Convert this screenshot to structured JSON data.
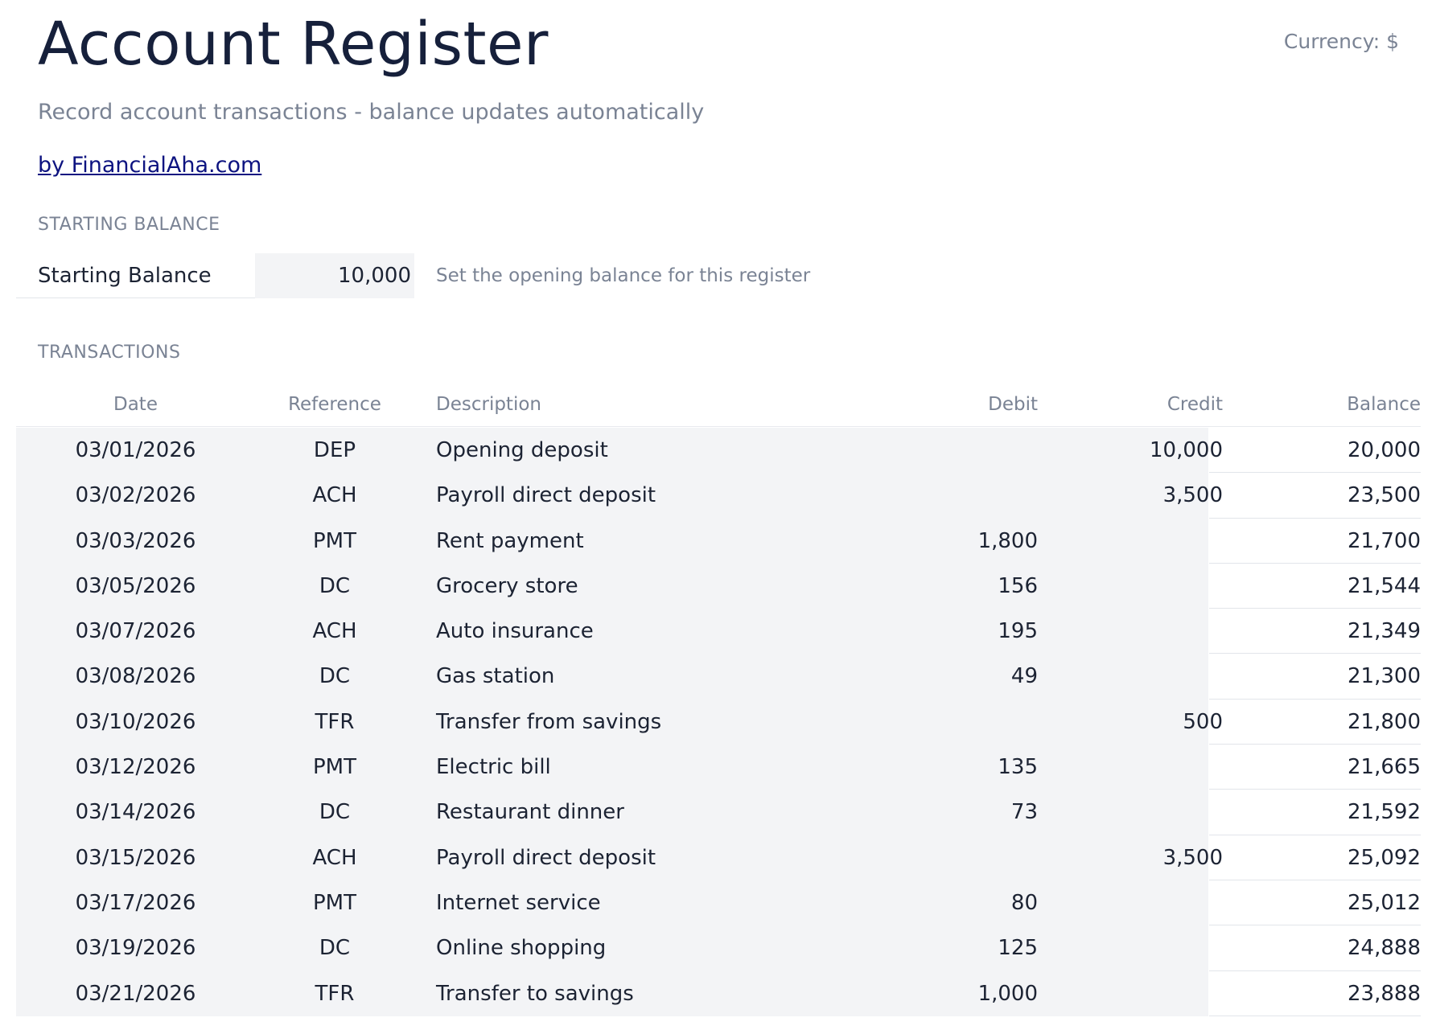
{
  "header": {
    "title": "Account Register",
    "currency": "Currency: $",
    "subtitle": "Record account transactions - balance updates automatically",
    "credit_link": "by FinancialAha.com"
  },
  "starting_balance": {
    "section_label": "STARTING BALANCE",
    "label": "Starting Balance",
    "value": "10,000",
    "hint": "Set the opening balance for this register"
  },
  "transactions": {
    "section_label": "TRANSACTIONS",
    "columns": {
      "date": "Date",
      "reference": "Reference",
      "description": "Description",
      "debit": "Debit",
      "credit": "Credit",
      "balance": "Balance"
    },
    "rows": [
      {
        "date": "03/01/2026",
        "reference": "DEP",
        "description": "Opening deposit",
        "debit": "",
        "credit": "10,000",
        "balance": "20,000"
      },
      {
        "date": "03/02/2026",
        "reference": "ACH",
        "description": "Payroll direct deposit",
        "debit": "",
        "credit": "3,500",
        "balance": "23,500"
      },
      {
        "date": "03/03/2026",
        "reference": "PMT",
        "description": "Rent payment",
        "debit": "1,800",
        "credit": "",
        "balance": "21,700"
      },
      {
        "date": "03/05/2026",
        "reference": "DC",
        "description": "Grocery store",
        "debit": "156",
        "credit": "",
        "balance": "21,544"
      },
      {
        "date": "03/07/2026",
        "reference": "ACH",
        "description": "Auto insurance",
        "debit": "195",
        "credit": "",
        "balance": "21,349"
      },
      {
        "date": "03/08/2026",
        "reference": "DC",
        "description": "Gas station",
        "debit": "49",
        "credit": "",
        "balance": "21,300"
      },
      {
        "date": "03/10/2026",
        "reference": "TFR",
        "description": "Transfer from savings",
        "debit": "",
        "credit": "500",
        "balance": "21,800"
      },
      {
        "date": "03/12/2026",
        "reference": "PMT",
        "description": "Electric bill",
        "debit": "135",
        "credit": "",
        "balance": "21,665"
      },
      {
        "date": "03/14/2026",
        "reference": "DC",
        "description": "Restaurant dinner",
        "debit": "73",
        "credit": "",
        "balance": "21,592"
      },
      {
        "date": "03/15/2026",
        "reference": "ACH",
        "description": "Payroll direct deposit",
        "debit": "",
        "credit": "3,500",
        "balance": "25,092"
      },
      {
        "date": "03/17/2026",
        "reference": "PMT",
        "description": "Internet service",
        "debit": "80",
        "credit": "",
        "balance": "25,012"
      },
      {
        "date": "03/19/2026",
        "reference": "DC",
        "description": "Online shopping",
        "debit": "125",
        "credit": "",
        "balance": "24,888"
      },
      {
        "date": "03/21/2026",
        "reference": "TFR",
        "description": "Transfer to savings",
        "debit": "1,000",
        "credit": "",
        "balance": "23,888"
      }
    ]
  }
}
